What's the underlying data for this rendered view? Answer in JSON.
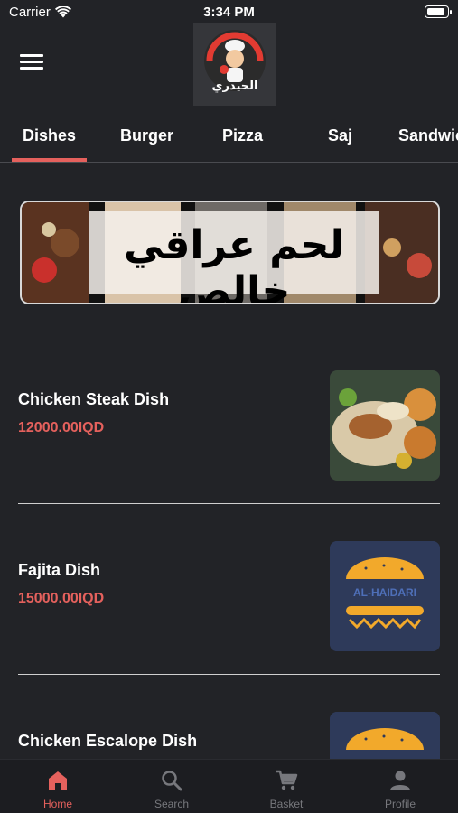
{
  "status_bar": {
    "carrier": "Carrier",
    "time": "3:34 PM"
  },
  "header": {
    "logo_text": "الحيدري"
  },
  "tabs": [
    {
      "label": "Dishes",
      "active": true
    },
    {
      "label": "Burger",
      "active": false
    },
    {
      "label": "Pizza",
      "active": false
    },
    {
      "label": "Saj",
      "active": false
    },
    {
      "label": "Sandwiches",
      "active": false
    }
  ],
  "banner": {
    "text": "لحم عراقي خالص"
  },
  "items": [
    {
      "name": "Chicken Steak Dish",
      "price": "12000.00IQD",
      "image": "chicken-steak-photo"
    },
    {
      "name": "Fajita Dish",
      "price": "15000.00IQD",
      "image": "al-haidari-logo"
    },
    {
      "name": "Chicken Escalope Dish",
      "price": "",
      "image": "al-haidari-logo"
    }
  ],
  "placeholder_brand": "AL-HAIDARI",
  "bottom_nav": [
    {
      "label": "Home",
      "icon": "home-icon",
      "active": true
    },
    {
      "label": "Search",
      "icon": "search-icon",
      "active": false
    },
    {
      "label": "Basket",
      "icon": "cart-icon",
      "active": false
    },
    {
      "label": "Profile",
      "icon": "person-icon",
      "active": false
    }
  ],
  "colors": {
    "accent": "#e5615d",
    "background": "#222327",
    "nav_background": "#1c1d21",
    "inactive": "#77787d"
  }
}
